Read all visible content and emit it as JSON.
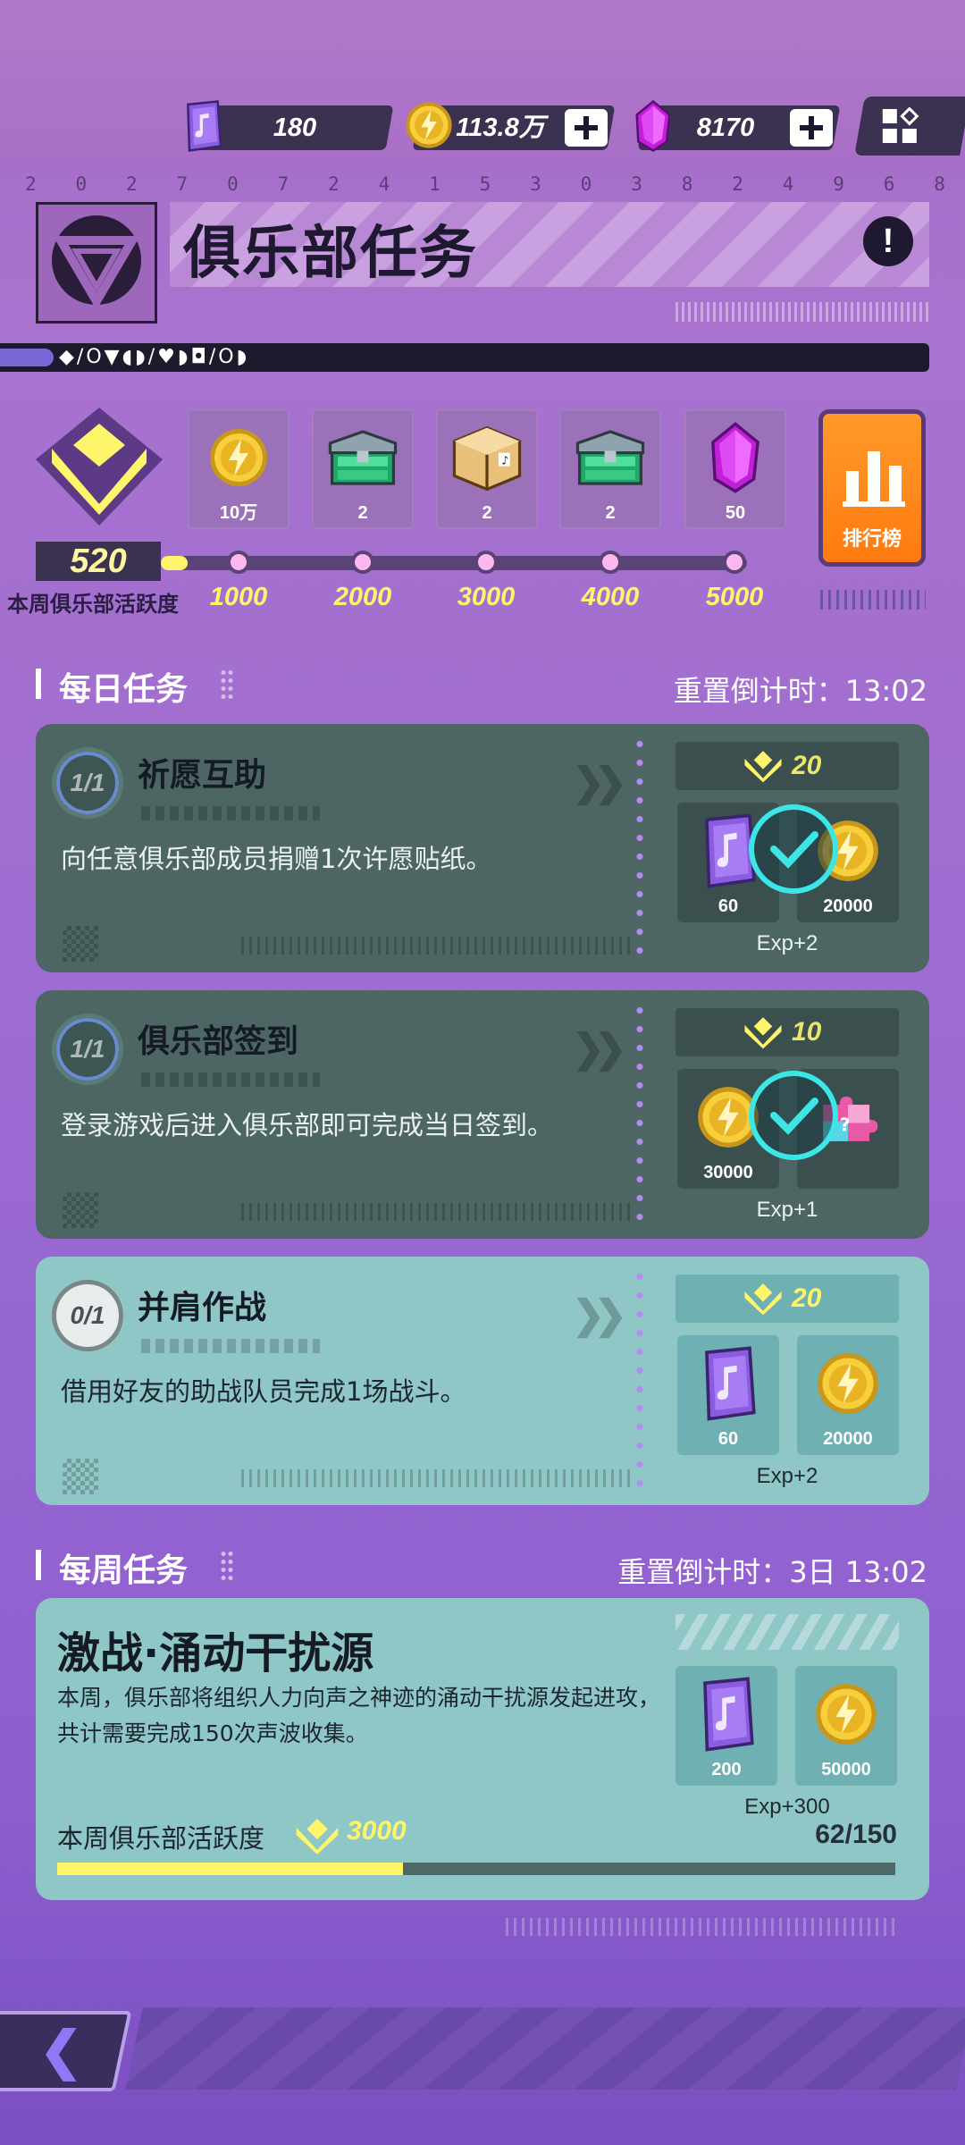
{
  "currency": {
    "tickets": "180",
    "coins": "113.8万",
    "gems": "8170"
  },
  "header": {
    "serial_digits": [
      "2",
      "0",
      "2",
      "7",
      "0",
      "7",
      "2",
      "4",
      "1",
      "5",
      "3",
      "0",
      "3",
      "8",
      "2",
      "4",
      "9",
      "6",
      "8"
    ],
    "title": "俱乐部任务",
    "symbol_text": "◆/O▼◖◗/♥◗◘/O◗"
  },
  "activity": {
    "score": "520",
    "label": "本周俱乐部活跃度",
    "progress_fraction": 0.104,
    "rewards": [
      {
        "icon": "coin-icon",
        "count": "10万",
        "milestone": "1000"
      },
      {
        "icon": "green-chest-icon",
        "count": "2",
        "milestone": "2000"
      },
      {
        "icon": "gift-box-icon",
        "count": "2",
        "milestone": "3000"
      },
      {
        "icon": "green-chest-icon",
        "count": "2",
        "milestone": "4000"
      },
      {
        "icon": "gem-icon",
        "count": "50",
        "milestone": "5000"
      }
    ],
    "leaderboard_label": "排行榜"
  },
  "daily": {
    "title": "每日任务",
    "timer": "重置倒计时：13:02",
    "tasks": [
      {
        "progress": "1/1",
        "name": "祈愿互助",
        "desc": "向任意俱乐部成员捐赠1次许愿贴纸。",
        "points": "20",
        "completed": true,
        "rewards": [
          {
            "icon": "ticket-icon",
            "count": "60"
          },
          {
            "icon": "coin-icon",
            "count": "20000"
          }
        ],
        "exp": "Exp+2"
      },
      {
        "progress": "1/1",
        "name": "俱乐部签到",
        "desc": "登录游戏后进入俱乐部即可完成当日签到。",
        "points": "10",
        "completed": true,
        "rewards": [
          {
            "icon": "coin-icon",
            "count": "30000"
          },
          {
            "icon": "puzzle-icon",
            "count": ""
          }
        ],
        "exp": "Exp+1"
      },
      {
        "progress": "0/1",
        "name": "并肩作战",
        "desc": "借用好友的助战队员完成1场战斗。",
        "points": "20",
        "completed": false,
        "rewards": [
          {
            "icon": "ticket-icon",
            "count": "60"
          },
          {
            "icon": "coin-icon",
            "count": "20000"
          }
        ],
        "exp": "Exp+2"
      }
    ]
  },
  "weekly": {
    "title": "每周任务",
    "timer": "重置倒计时：3日 13:02",
    "task": {
      "name": "激战·涌动干扰源",
      "desc": "本周，俱乐部将组织人力向声之神迹的涌动干扰源发起进攻，共计需要完成150次声波收集。",
      "activity_label": "本周俱乐部活跃度",
      "activity_value": "3000",
      "progress": "62/150",
      "progress_fraction": 0.413,
      "rewards": [
        {
          "icon": "ticket-icon",
          "count": "200"
        },
        {
          "icon": "coin-icon",
          "count": "50000"
        }
      ],
      "exp": "Exp+300"
    }
  },
  "colors": {
    "accent_yellow": "#fff56a",
    "check_cyan": "#3ce6e6",
    "rank_orange": "#ff8a1a"
  }
}
